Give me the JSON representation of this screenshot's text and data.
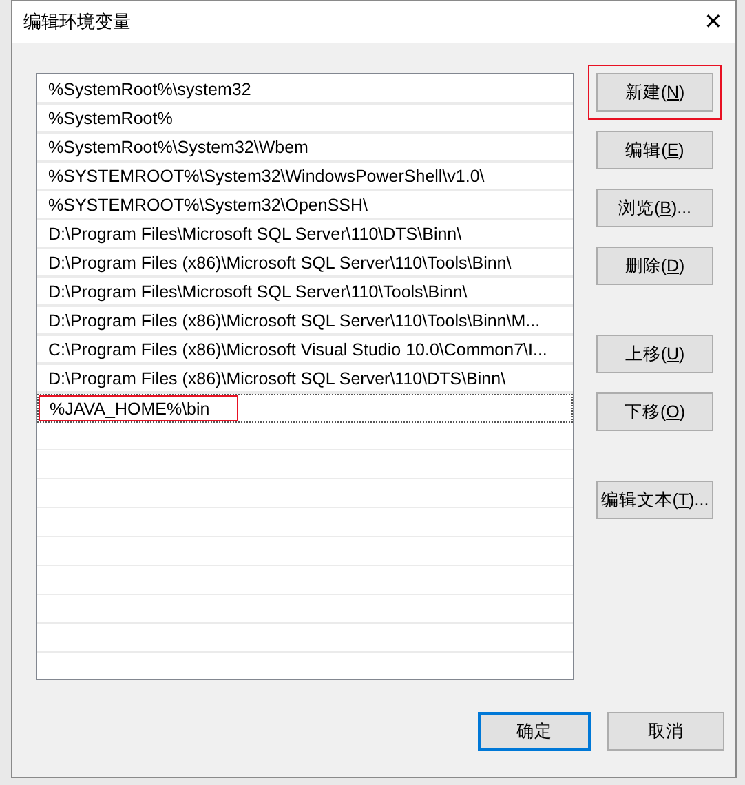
{
  "window": {
    "title": "编辑环境变量",
    "close": "✕"
  },
  "paths": [
    {
      "kind": "entry",
      "text": "%SystemRoot%\\system32"
    },
    {
      "kind": "entry",
      "text": "%SystemRoot%"
    },
    {
      "kind": "entry",
      "text": "%SystemRoot%\\System32\\Wbem"
    },
    {
      "kind": "entry",
      "text": "%SYSTEMROOT%\\System32\\WindowsPowerShell\\v1.0\\"
    },
    {
      "kind": "entry",
      "text": "%SYSTEMROOT%\\System32\\OpenSSH\\"
    },
    {
      "kind": "entry",
      "text": "D:\\Program Files\\Microsoft SQL Server\\110\\DTS\\Binn\\"
    },
    {
      "kind": "entry",
      "text": "D:\\Program Files (x86)\\Microsoft SQL Server\\110\\Tools\\Binn\\"
    },
    {
      "kind": "entry",
      "text": "D:\\Program Files\\Microsoft SQL Server\\110\\Tools\\Binn\\"
    },
    {
      "kind": "entry",
      "text": "D:\\Program Files (x86)\\Microsoft SQL Server\\110\\Tools\\Binn\\M..."
    },
    {
      "kind": "entry",
      "text": "C:\\Program Files (x86)\\Microsoft Visual Studio 10.0\\Common7\\I..."
    },
    {
      "kind": "entry",
      "text": "D:\\Program Files (x86)\\Microsoft SQL Server\\110\\DTS\\Binn\\"
    },
    {
      "kind": "editing",
      "text": "%JAVA_HOME%\\bin",
      "highlighted": true
    }
  ],
  "button_groups": [
    [
      {
        "label": "新建(",
        "mnemonic": "N",
        "label_end": ")",
        "highlighted": true
      },
      {
        "label": "编辑(",
        "mnemonic": "E",
        "label_end": ")",
        "highlighted": false
      },
      {
        "label": "浏览(",
        "mnemonic": "B",
        "label_end": ")...",
        "highlighted": false
      },
      {
        "label": "删除(",
        "mnemonic": "D",
        "label_end": ")",
        "highlighted": false
      }
    ],
    [
      {
        "label": "上移(",
        "mnemonic": "U",
        "label_end": ")",
        "highlighted": false
      },
      {
        "label": "下移(",
        "mnemonic": "O",
        "label_end": ")",
        "highlighted": false
      }
    ],
    [
      {
        "label": "编辑文本(",
        "mnemonic": "T",
        "label_end": ")...",
        "highlighted": false
      }
    ]
  ],
  "footer_buttons": [
    {
      "label": "确定",
      "default": true
    },
    {
      "label": "取消",
      "default": false
    }
  ]
}
